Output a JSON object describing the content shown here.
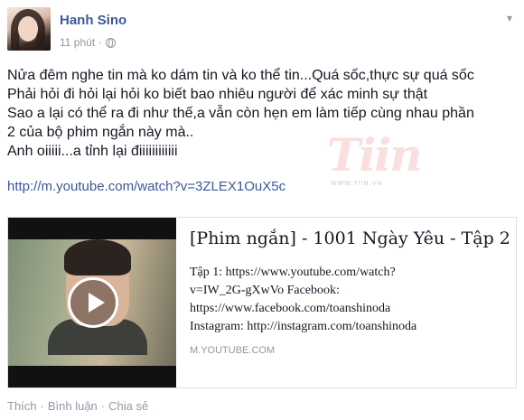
{
  "post": {
    "author": "Hanh Sino",
    "time": "11 phút",
    "separator": "·",
    "lines": [
      "Nửa đêm nghe tin mà ko dám tin và ko thể tin...Quá sốc,thực sự quá sốc",
      "Phải hỏi đi hỏi lại hỏi ko biết bao nhiêu người để xác minh sự thật",
      "Sao a lại có thể ra đi như thế,a vẫn còn hẹn em làm tiếp cùng nhau phần",
      "2 của bộ phim ngắn này mà..",
      "Anh oiiiii...a tỉnh lại điiiiiiiiiiii"
    ],
    "link": "http://m.youtube.com/watch?v=3ZLEX1OuX5c"
  },
  "watermark": {
    "text": "Tiin",
    "sub": "WWW.TIIN.VN"
  },
  "card": {
    "title": "[Phim ngắn] - 1001 Ngày Yêu - Tập 2",
    "desc_lines": [
      "Tập 1: https://www.youtube.com/watch?",
      "v=IW_2G-gXwVo Facebook:",
      "https://www.facebook.com/toanshinoda",
      "Instagram: http://instagram.com/toanshinoda"
    ],
    "domain": "M.YOUTUBE.COM"
  },
  "actions": {
    "like": "Thích",
    "comment": "Bình luận",
    "share": "Chia sẻ",
    "dot": "·"
  },
  "icons": {
    "privacy": "globe-icon",
    "menu": "chevron-down-icon",
    "play": "play-icon"
  },
  "colors": {
    "link": "#3b5998",
    "muted": "#9197a3",
    "text": "#141823"
  }
}
